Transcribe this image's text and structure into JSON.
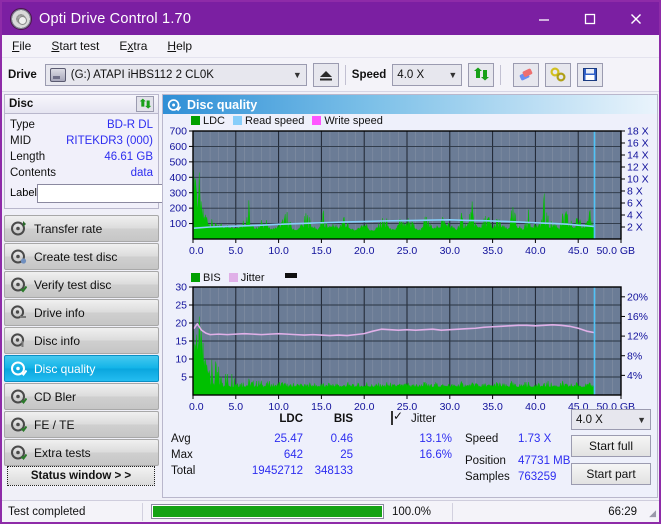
{
  "window": {
    "title": "Opti Drive Control 1.70",
    "icon": "disc-icon",
    "minimize": "minimize",
    "maximize": "maximize",
    "close": "close"
  },
  "menu": {
    "items": [
      "File",
      "Start test",
      "Extra",
      "Help"
    ]
  },
  "toolbar": {
    "drive_label": "Drive",
    "drive_value": "(G:)  ATAPI iHBS112  2 CL0K",
    "eject_icon": "eject-icon",
    "speed_label": "Speed",
    "speed_value": "4.0 X",
    "refresh_icon": "refresh-icon",
    "erase_icon": "eraser-icon",
    "tools_icon": "tools-icon",
    "save_icon": "save-icon"
  },
  "disc": {
    "panel_title": "Disc",
    "refresh_icon": "refresh-icon",
    "rows": [
      {
        "key": "Type",
        "value": "BD-R DL"
      },
      {
        "key": "MID",
        "value": "RITEKDR3 (000)"
      },
      {
        "key": "Length",
        "value": "46.61 GB"
      },
      {
        "key": "Contents",
        "value": "data"
      }
    ],
    "label_key": "Label",
    "label_value": "",
    "label_placeholder": "",
    "label_button_icon": "cd-icon"
  },
  "nav": {
    "items": [
      {
        "label": "Transfer rate",
        "selected": false
      },
      {
        "label": "Create test disc",
        "selected": false
      },
      {
        "label": "Verify test disc",
        "selected": false
      },
      {
        "label": "Drive info",
        "selected": false
      },
      {
        "label": "Disc info",
        "selected": false
      },
      {
        "label": "Disc quality",
        "selected": true
      },
      {
        "label": "CD Bler",
        "selected": false
      },
      {
        "label": "FE / TE",
        "selected": false
      },
      {
        "label": "Extra tests",
        "selected": false
      }
    ],
    "status_window": "Status window > >"
  },
  "content": {
    "header_title": "Disc quality",
    "header_icon": "disc-quality-icon"
  },
  "stats": {
    "col_headers": [
      "LDC",
      "BIS"
    ],
    "rows": [
      {
        "label": "Avg",
        "ldc": "25.47",
        "bis": "0.46",
        "jitter": "13.1%"
      },
      {
        "label": "Max",
        "ldc": "642",
        "bis": "25",
        "jitter": "16.6%"
      },
      {
        "label": "Total",
        "ldc": "19452712",
        "bis": "348133",
        "jitter": ""
      }
    ],
    "jitter_label": "Jitter",
    "jitter_checked": true,
    "speed_label": "Speed",
    "speed_value": "1.73 X",
    "position_label": "Position",
    "position_value": "47731 MB",
    "samples_label": "Samples",
    "samples_value": "763259",
    "speed_select": "4.0 X",
    "start_full": "Start full",
    "start_part": "Start part"
  },
  "statusbar": {
    "message": "Test completed",
    "progress_text": "100.0%",
    "progress_value": 100,
    "time": "66:29"
  },
  "colors": {
    "title_bar": "#7b1fa2",
    "ldc": "#00c000",
    "bis": "#00c000",
    "read_speed": "#87cefa",
    "write_speed": "#ff66ff",
    "jitter": "#e0b0e8",
    "plot_bg": "#6b7c96",
    "value_text": "#2d2df0",
    "progress": "#15a215",
    "selection": "#13b4e8"
  },
  "chart_data": [
    {
      "type": "area",
      "id": "ldc-chart",
      "title": "",
      "xlabel": "GB",
      "ylabel": "",
      "xlim": [
        0,
        50
      ],
      "xticks": [
        0.0,
        5.0,
        10.0,
        15.0,
        20.0,
        25.0,
        30.0,
        35.0,
        40.0,
        45.0,
        50.0
      ],
      "xticklabels": [
        "0.0",
        "5.0",
        "10.0",
        "15.0",
        "20.0",
        "25.0",
        "30.0",
        "35.0",
        "40.0",
        "45.0",
        "50.0 GB"
      ],
      "ylim": [
        0,
        700
      ],
      "yticks": [
        100,
        200,
        300,
        400,
        500,
        600,
        700
      ],
      "yticklabels": [
        "100",
        "200",
        "300",
        "400",
        "500",
        "600",
        "700"
      ],
      "y2lim": [
        0,
        18
      ],
      "y2ticks": [
        2,
        4,
        6,
        8,
        10,
        12,
        14,
        16,
        18
      ],
      "y2ticklabels": [
        "2 X",
        "4 X",
        "6 X",
        "8 X",
        "10 X",
        "12 X",
        "14 X",
        "16 X",
        "18 X"
      ],
      "grid": true,
      "legend": [
        "LDC",
        "Read speed",
        "Write speed"
      ],
      "legend_position": "top-left",
      "data_end_x": 46.9,
      "series": [
        {
          "name": "LDC",
          "color": "#00c000",
          "axis": "left",
          "x": [
            0.1,
            0.3,
            0.5,
            0.7,
            0.9,
            1.1,
            1.3,
            1.6,
            1.9,
            2.2,
            2.6,
            3.0,
            3.4,
            3.8,
            4.3,
            4.8,
            5.3,
            5.8,
            6.3,
            6.8,
            7.3,
            7.8,
            8.3,
            8.8,
            9.3,
            9.8,
            10.4,
            11.0,
            11.6,
            12.2,
            12.8,
            13.4,
            14.0,
            14.6,
            15.2,
            15.8,
            16.4,
            17.0,
            17.6,
            18.2,
            18.8,
            19.4,
            20.0,
            20.6,
            21.2,
            21.8,
            22.4,
            23.0,
            23.6,
            24.2,
            24.8,
            25.4,
            26.0,
            26.6,
            27.2,
            27.8,
            28.4,
            29.0,
            29.6,
            30.2,
            30.8,
            31.4,
            32.0,
            32.6,
            33.2,
            33.8,
            34.4,
            35.0,
            35.6,
            36.2,
            36.8,
            37.4,
            38.0,
            38.6,
            39.2,
            39.8,
            40.4,
            41.0,
            41.6,
            42.2,
            42.8,
            43.4,
            44.0,
            44.6,
            45.2,
            45.8,
            46.4,
            46.9
          ],
          "values": [
            500,
            640,
            300,
            480,
            255,
            215,
            200,
            195,
            145,
            130,
            105,
            95,
            130,
            88,
            110,
            82,
            95,
            130,
            420,
            110,
            75,
            88,
            200,
            78,
            70,
            82,
            140,
            200,
            70,
            62,
            120,
            200,
            90,
            65,
            200,
            75,
            130,
            70,
            240,
            80,
            60,
            75,
            165,
            62,
            58,
            110,
            190,
            72,
            60,
            150,
            88,
            225,
            70,
            62,
            170,
            95,
            72,
            200,
            140,
            95,
            62,
            180,
            105,
            250,
            88,
            110,
            215,
            72,
            165,
            92,
            70,
            240,
            100,
            62,
            195,
            130,
            88,
            320,
            110,
            145,
            70,
            230,
            150,
            78,
            300,
            95,
            190,
            90
          ]
        },
        {
          "name": "Read speed",
          "color": "#87cefa",
          "axis": "right",
          "x": [
            0.1,
            2,
            4,
            6,
            8,
            10,
            12,
            14,
            16,
            18,
            20,
            22,
            24,
            26,
            28,
            30,
            32,
            34,
            36,
            38,
            40,
            42,
            44,
            45,
            46,
            46.9
          ],
          "values": [
            1.8,
            2.0,
            2.1,
            2.2,
            2.3,
            2.45,
            2.55,
            2.65,
            2.75,
            2.85,
            2.9,
            3.0,
            3.05,
            3.1,
            3.15,
            3.2,
            3.1,
            3.05,
            2.95,
            2.85,
            2.7,
            2.6,
            2.45,
            2.3,
            2.2,
            2.1
          ]
        },
        {
          "name": "Write speed",
          "color": "#ff66ff",
          "axis": "right",
          "x": [],
          "values": []
        }
      ],
      "marker_line": {
        "x": 46.9,
        "color": "#4fc3f7"
      }
    },
    {
      "type": "area",
      "id": "bis-jitter-chart",
      "title": "",
      "xlabel": "GB",
      "ylabel": "",
      "xlim": [
        0,
        50
      ],
      "xticks": [
        0.0,
        5.0,
        10.0,
        15.0,
        20.0,
        25.0,
        30.0,
        35.0,
        40.0,
        45.0,
        50.0
      ],
      "xticklabels": [
        "0.0",
        "5.0",
        "10.0",
        "15.0",
        "20.0",
        "25.0",
        "30.0",
        "35.0",
        "40.0",
        "45.0",
        "50.0 GB"
      ],
      "ylim": [
        0,
        30
      ],
      "yticks": [
        5,
        10,
        15,
        20,
        25,
        30
      ],
      "yticklabels": [
        "5",
        "10",
        "15",
        "20",
        "25",
        "30"
      ],
      "y2lim": [
        0,
        22
      ],
      "y2ticks": [
        4,
        8,
        12,
        16,
        20
      ],
      "y2ticklabels": [
        "4%",
        "8%",
        "12%",
        "16%",
        "20%"
      ],
      "grid": true,
      "legend": [
        "BIS",
        "Jitter"
      ],
      "legend_position": "top-left",
      "data_end_x": 46.9,
      "series": [
        {
          "name": "BIS",
          "color": "#00c000",
          "axis": "left",
          "x": [
            0.1,
            0.4,
            0.7,
            1.0,
            1.3,
            1.6,
            2.0,
            2.4,
            2.8,
            3.3,
            3.8,
            4.3,
            4.8,
            5.4,
            6.0,
            6.6,
            7.2,
            7.8,
            8.4,
            9.0,
            9.6,
            10.2,
            10.8,
            11.4,
            12.0,
            12.6,
            13.2,
            13.8,
            14.4,
            15.0,
            15.6,
            16.2,
            16.8,
            17.4,
            18.0,
            18.6,
            19.2,
            19.8,
            20.4,
            21.0,
            21.6,
            22.2,
            22.8,
            23.4,
            24.0,
            24.6,
            25.2,
            25.8,
            26.4,
            27.0,
            27.6,
            28.2,
            28.8,
            29.4,
            30.0,
            30.6,
            31.2,
            31.8,
            32.4,
            33.0,
            33.6,
            34.2,
            34.8,
            35.4,
            36.0,
            36.6,
            37.2,
            37.8,
            38.4,
            39.0,
            39.6,
            40.2,
            40.8,
            41.4,
            42.0,
            42.6,
            43.2,
            43.8,
            44.4,
            45.0,
            45.6,
            46.2,
            46.9
          ],
          "values": [
            20,
            25,
            23,
            18,
            14,
            12,
            11,
            9,
            10,
            7,
            8,
            6,
            10,
            5,
            4.5,
            5,
            4,
            4.5,
            3.5,
            4,
            3,
            4.5,
            3.5,
            3,
            4,
            3.5,
            3,
            4,
            3,
            3.5,
            3,
            4,
            3.5,
            3,
            4,
            3,
            3.5,
            3,
            4.5,
            3,
            3.5,
            3,
            4,
            3,
            3.5,
            3,
            4,
            3.5,
            3,
            4,
            3,
            3.5,
            4,
            3,
            3.5,
            3,
            4,
            3.5,
            3,
            4.5,
            3,
            3.5,
            3,
            4,
            3.5,
            3,
            4,
            3,
            3.5,
            4,
            3,
            3.5,
            3,
            4,
            3.5,
            3,
            4,
            3,
            3.5,
            4,
            3,
            3.5,
            3
          ]
        },
        {
          "name": "Jitter",
          "color": "#e0b0e8",
          "axis": "right",
          "x": [
            0.1,
            0.5,
            1.0,
            1.5,
            2.0,
            3.0,
            4.0,
            5.0,
            6.0,
            7.0,
            8.0,
            9.0,
            10.0,
            11.0,
            12.0,
            13.0,
            14.0,
            15.0,
            16.0,
            17.0,
            18.0,
            19.0,
            20.0,
            21.0,
            22.0,
            23.0,
            24.0,
            25.0,
            26.0,
            27.0,
            28.0,
            29.0,
            30.0,
            31.0,
            32.0,
            33.0,
            34.0,
            35.0,
            36.0,
            37.0,
            38.0,
            39.0,
            40.0,
            41.0,
            42.0,
            43.0,
            44.0,
            45.0,
            46.0,
            46.9
          ],
          "values": [
            13.5,
            14.5,
            13.2,
            12.6,
            12.3,
            12.4,
            12.3,
            12.4,
            12.5,
            12.4,
            12.3,
            12.4,
            12.5,
            12.4,
            12.3,
            12.2,
            12.3,
            12.2,
            12.1,
            12.2,
            12.1,
            12.3,
            12.5,
            13.0,
            13.4,
            13.3,
            13.2,
            13.3,
            13.2,
            13.3,
            13.4,
            13.2,
            13.3,
            13.4,
            13.5,
            13.6,
            13.8,
            13.9,
            14.0,
            14.1,
            14.2,
            14.2,
            14.1,
            14.2,
            14.3,
            14.2,
            14.0,
            13.6,
            13.0,
            12.7
          ]
        }
      ],
      "marker_line": {
        "x": 46.9,
        "color": "#4fc3f7"
      }
    }
  ]
}
